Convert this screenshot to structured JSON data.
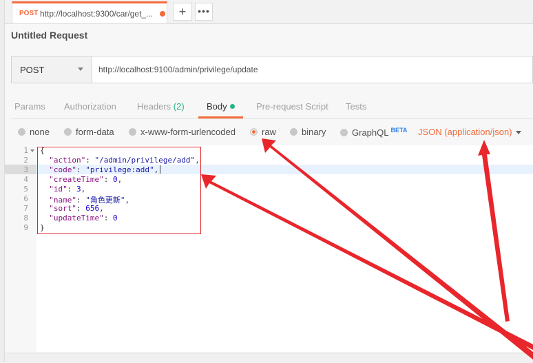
{
  "tab": {
    "method": "POST",
    "url": "http://localhost:9300/car/get_..."
  },
  "tab_actions": {
    "add": "+",
    "more": "•••"
  },
  "request": {
    "title": "Untitled Request",
    "method": "POST",
    "url": "http://localhost:9100/admin/privilege/update"
  },
  "req_tabs": {
    "params": "Params",
    "authorization": "Authorization",
    "headers": "Headers",
    "headers_count": "(2)",
    "body": "Body",
    "prerequest": "Pre-request Script",
    "tests": "Tests"
  },
  "body_types": {
    "none": "none",
    "form_data": "form-data",
    "urlencoded": "x-www-form-urlencoded",
    "raw": "raw",
    "binary": "binary",
    "graphql": "GraphQL",
    "beta": "BETA",
    "selected_format": "JSON (application/json)"
  },
  "editor": {
    "line_numbers": [
      "1",
      "2",
      "3",
      "4",
      "5",
      "6",
      "7",
      "8",
      "9"
    ],
    "lines": {
      "l1": "{",
      "l2_key": "\"action\"",
      "l2_val": "\"/admin/privilege/add\"",
      "l3_key": "\"code\"",
      "l3_val": "\"privilege:add\"",
      "l4_key": "\"createTime\"",
      "l4_val": "0",
      "l5_key": "\"id\"",
      "l5_val": "3",
      "l6_key": "\"name\"",
      "l6_val": "\"角色更新\"",
      "l7_key": "\"sort\"",
      "l7_val": "656",
      "l8_key": "\"updateTime\"",
      "l8_val": "0",
      "l9": "}"
    }
  },
  "colors": {
    "accent": "#f26b3a",
    "success": "#26b47f",
    "annotation": "#e0262b",
    "beta": "#2f80ed"
  }
}
